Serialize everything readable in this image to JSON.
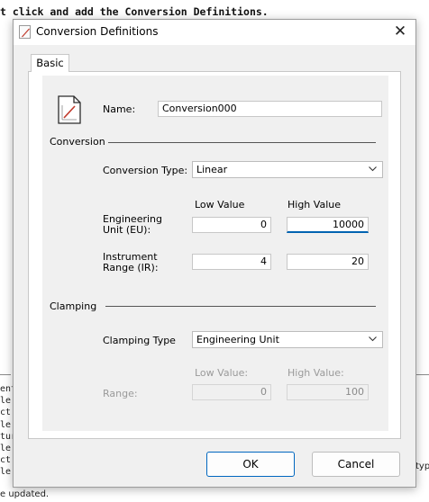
{
  "background": {
    "top_text": "t click and add the Conversion Definitions.",
    "left_lines": [
      "ents",
      "le u",
      "ct c",
      "le u",
      "ture",
      "le t",
      "ct c",
      "le u"
    ],
    "right_text": "typ",
    "bottom_text": "e updated."
  },
  "dialog": {
    "title": "Conversion Definitions",
    "close_glyph": "✕",
    "tab_label": "Basic",
    "name_label": "Name:",
    "name_value": "Conversion000",
    "conversion_section": "Conversion",
    "conversion_type_label": "Conversion Type:",
    "conversion_type_value": "Linear",
    "low_value_header": "Low Value",
    "high_value_header": "High Value",
    "eu_label_line1": "Engineering",
    "eu_label_line2": "Unit (EU):",
    "eu_low": "0",
    "eu_high": "10000",
    "ir_label_line1": "Instrument",
    "ir_label_line2": "Range (IR):",
    "ir_low": "4",
    "ir_high": "20",
    "clamping_section": "Clamping",
    "clamping_type_label": "Clamping Type",
    "clamping_type_value": "Engineering Unit",
    "clamp_low_header": "Low Value:",
    "clamp_high_header": "High Value:",
    "range_label": "Range:",
    "range_low": "0",
    "range_high": "100",
    "ok_label": "OK",
    "cancel_label": "Cancel"
  },
  "colors": {
    "accent": "#0067c0",
    "dialog_bg": "#f0f0f0",
    "disabled_text": "#9a9a9a"
  },
  "icons": [
    "conversion-icon",
    "close-icon",
    "chevron-down-icon",
    "document-chart-icon"
  ]
}
